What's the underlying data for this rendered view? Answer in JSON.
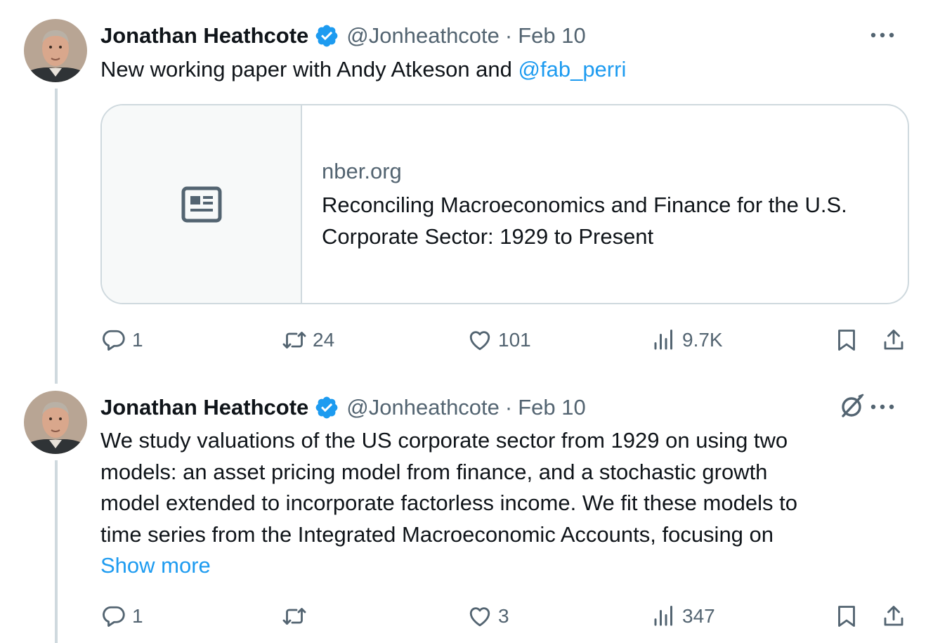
{
  "tweets": [
    {
      "author": {
        "name": "Jonathan Heathcote",
        "handle": "@Jonheathcote",
        "verified": true
      },
      "date": "Feb 10",
      "text_plain": "New working paper with Andy Atkeson and ",
      "mention": "@fab_perri",
      "card": {
        "domain": "nber.org",
        "title": "Reconciling Macroeconomics and Finance for the U.S. Corporate Sector: 1929 to Present"
      },
      "stats": {
        "replies": "1",
        "reposts": "24",
        "likes": "101",
        "views": "9.7K"
      }
    },
    {
      "author": {
        "name": "Jonathan Heathcote",
        "handle": "@Jonheathcote",
        "verified": true
      },
      "date": "Feb 10",
      "lines": [
        "We study valuations of the US corporate sector from 1929 on using two",
        "models: an asset pricing model from finance, and a stochastic growth",
        "model extended to incorporate factorless income. We fit these models to",
        "time series from the Integrated Macroeconomic Accounts, focusing on"
      ],
      "show_more": "Show more",
      "stats": {
        "replies": "1",
        "reposts": "",
        "likes": "3",
        "views": "347"
      }
    }
  ],
  "colors": {
    "accent": "#1d9bf0",
    "muted": "#536471",
    "border": "#cfd9de",
    "text": "#0f1419"
  },
  "icons": [
    "verified-badge-icon",
    "more-icon",
    "grok-icon",
    "article-icon",
    "reply-icon",
    "repost-icon",
    "like-icon",
    "views-icon",
    "bookmark-icon",
    "share-icon"
  ]
}
